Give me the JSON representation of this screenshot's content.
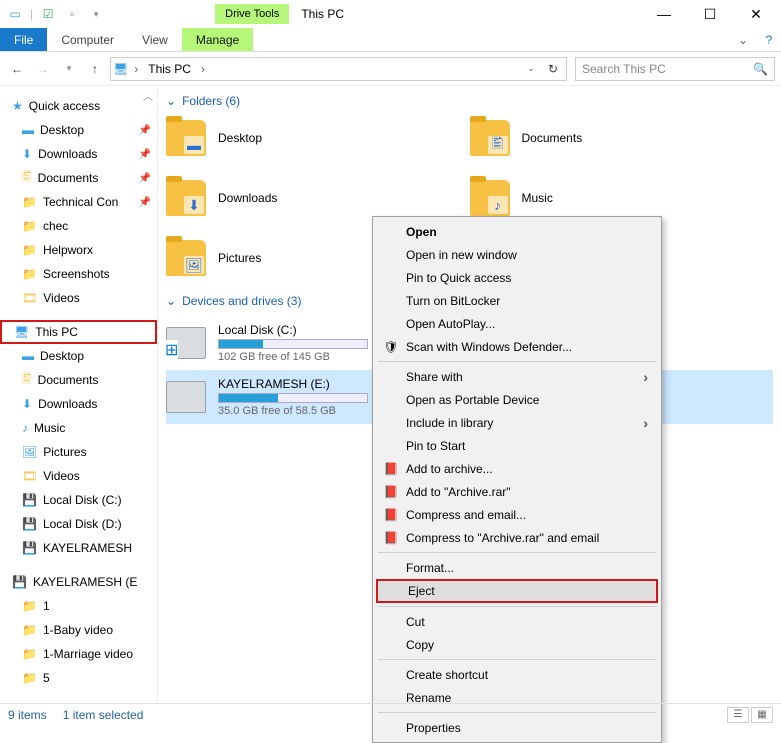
{
  "title": "This PC",
  "ribbon": {
    "file": "File",
    "computer": "Computer",
    "view": "View",
    "drive_tools": "Drive Tools",
    "manage": "Manage"
  },
  "breadcrumb": {
    "root": "This PC"
  },
  "search": {
    "placeholder": "Search This PC"
  },
  "sidebar": {
    "quick": "Quick access",
    "desktop": "Desktop",
    "downloads": "Downloads",
    "documents": "Documents",
    "tech": "Technical Con",
    "chec": "chec",
    "helpworx": "Helpworx",
    "screenshots": "Screenshots",
    "videos": "Videos",
    "thispc": "This PC",
    "desktop2": "Desktop",
    "documents2": "Documents",
    "downloads2": "Downloads",
    "music": "Music",
    "pictures": "Pictures",
    "videos2": "Videos",
    "localc": "Local Disk (C:)",
    "locald": "Local Disk (D:)",
    "kayel": "KAYELRAMESH",
    "kayelg": "KAYELRAMESH (E",
    "f1": "1",
    "f2": "1-Baby video",
    "f3": "1-Marriage video",
    "f4": "5"
  },
  "sections": {
    "folders": "Folders (6)",
    "drives": "Devices and drives (3)"
  },
  "folders": {
    "desktop": "Desktop",
    "documents": "Documents",
    "downloads": "Downloads",
    "music": "Music",
    "pictures": "Pictures"
  },
  "drives": {
    "c": {
      "name": "Local Disk (C:)",
      "free": "102 GB free of 145 GB",
      "pct": 30
    },
    "e": {
      "name": "KAYELRAMESH (E:)",
      "free": "35.0 GB free of 58.5 GB",
      "pct": 40
    }
  },
  "context": {
    "open": "Open",
    "open_new": "Open in new window",
    "pin_qa": "Pin to Quick access",
    "bitlocker": "Turn on BitLocker",
    "autoplay": "Open AutoPlay...",
    "defender": "Scan with Windows Defender...",
    "share": "Share with",
    "portable": "Open as Portable Device",
    "library": "Include in library",
    "pin_start": "Pin to Start",
    "add_arch": "Add to archive...",
    "add_rar": "Add to \"Archive.rar\"",
    "comp_email": "Compress and email...",
    "comp_rar": "Compress to \"Archive.rar\" and email",
    "format": "Format...",
    "eject": "Eject",
    "cut": "Cut",
    "copy": "Copy",
    "shortcut": "Create shortcut",
    "rename": "Rename",
    "properties": "Properties"
  },
  "status": {
    "items": "9 items",
    "selected": "1 item selected"
  }
}
